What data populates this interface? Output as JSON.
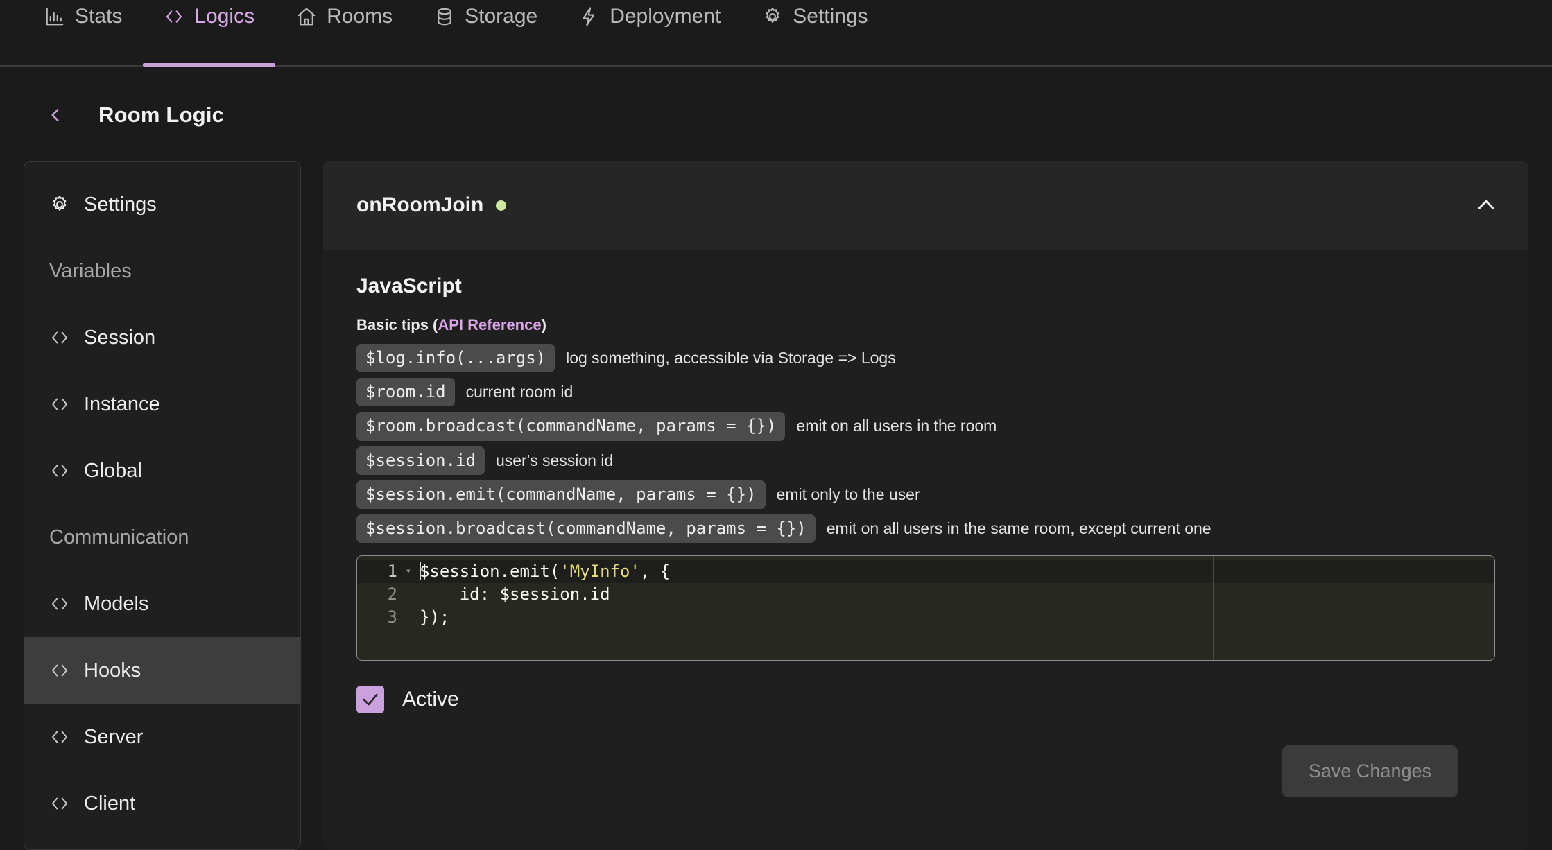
{
  "topnav": {
    "tabs": [
      {
        "label": "Stats",
        "icon": "bar-chart-icon",
        "active": false
      },
      {
        "label": "Logics",
        "icon": "code-brackets-icon",
        "active": true
      },
      {
        "label": "Rooms",
        "icon": "house-icon",
        "active": false
      },
      {
        "label": "Storage",
        "icon": "database-icon",
        "active": false
      },
      {
        "label": "Deployment",
        "icon": "lightning-bolt-icon",
        "active": false
      },
      {
        "label": "Settings",
        "icon": "gear-icon",
        "active": false
      }
    ]
  },
  "page": {
    "back_icon": "chevron-left-icon",
    "title": "Room Logic"
  },
  "sidebar": {
    "items": [
      {
        "label": "Settings",
        "icon": "gear-icon",
        "type": "item",
        "selected": false
      },
      {
        "label": "Variables",
        "icon": "",
        "type": "group",
        "selected": false
      },
      {
        "label": "Session",
        "icon": "code-brackets-icon",
        "type": "item",
        "selected": false
      },
      {
        "label": "Instance",
        "icon": "code-brackets-icon",
        "type": "item",
        "selected": false
      },
      {
        "label": "Global",
        "icon": "code-brackets-icon",
        "type": "item",
        "selected": false
      },
      {
        "label": "Communication",
        "icon": "",
        "type": "group",
        "selected": false
      },
      {
        "label": "Models",
        "icon": "code-brackets-icon",
        "type": "item",
        "selected": false
      },
      {
        "label": "Hooks",
        "icon": "code-brackets-icon",
        "type": "item",
        "selected": true
      },
      {
        "label": "Server",
        "icon": "code-brackets-icon",
        "type": "item",
        "selected": false
      },
      {
        "label": "Client",
        "icon": "code-brackets-icon",
        "type": "item",
        "selected": false
      }
    ]
  },
  "panel": {
    "hook_name": "onRoomJoin",
    "status_dot_color": "#cfe8a0",
    "collapse_icon": "chevron-up-icon",
    "language_title": "JavaScript",
    "tips_label": "Basic tips (",
    "tips_link": "API Reference",
    "tips_label_close": ")",
    "tips": [
      {
        "code": "$log.info(...args)",
        "desc": "log something, accessible via Storage => Logs"
      },
      {
        "code": "$room.id",
        "desc": "current room id"
      },
      {
        "code": "$room.broadcast(commandName, params = {})",
        "desc": "emit on all users in the room"
      },
      {
        "code": "$session.id",
        "desc": "user's session id"
      },
      {
        "code": "$session.emit(commandName, params = {})",
        "desc": "emit only to the user"
      },
      {
        "code": "$session.broadcast(commandName, params = {})",
        "desc": "emit on all users in the same room, except current one"
      }
    ],
    "editor": {
      "lines": [
        {
          "number": "1",
          "active": true,
          "fold": "▾",
          "pre": "$session.emit(",
          "str": "'MyInfo'",
          "post": ", {"
        },
        {
          "number": "2",
          "active": false,
          "fold": "",
          "pre": "    id: $session.id",
          "str": "",
          "post": ""
        },
        {
          "number": "3",
          "active": false,
          "fold": "",
          "pre": "});",
          "str": "",
          "post": ""
        }
      ]
    },
    "active_checkbox": {
      "label": "Active",
      "checked": true,
      "color": "#caa0dd"
    },
    "save_button": {
      "label": "Save Changes",
      "disabled": true
    }
  }
}
